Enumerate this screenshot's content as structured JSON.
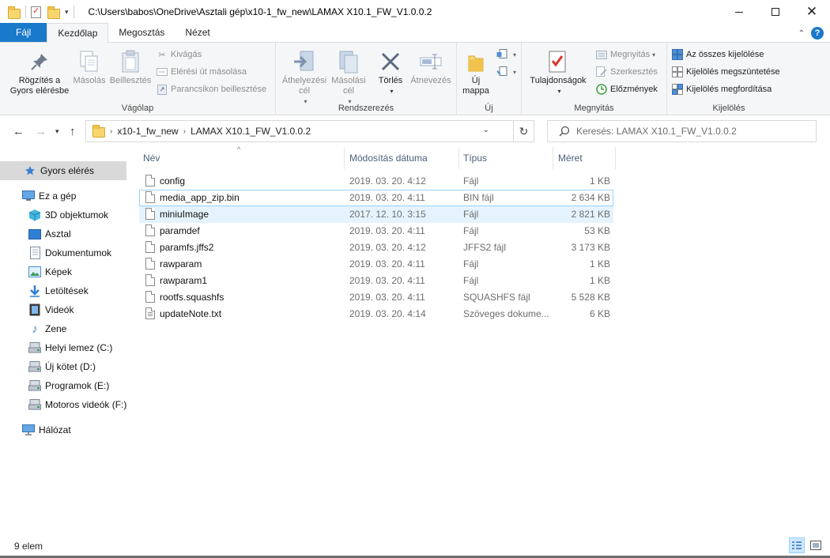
{
  "window": {
    "title_path": "C:\\Users\\babos\\OneDrive\\Asztali gép\\x10-1_fw_new\\LAMAX X10.1_FW_V1.0.0.2"
  },
  "tabs": [
    "Fájl",
    "Kezdőlap",
    "Megosztás",
    "Nézet"
  ],
  "ribbon": {
    "clipboard": {
      "pin": "Rögzítés a Gyors elérésbe",
      "copy": "Másolás",
      "paste": "Beillesztés",
      "cut": "Kivágás",
      "copy_path": "Elérési út másolása",
      "paste_shortcut": "Parancsikon beillesztése",
      "label": "Vágólap"
    },
    "organize": {
      "move_to": "Áthelyezési cél",
      "copy_to": "Másolási cél",
      "delete": "Törlés",
      "rename": "Átnevezés",
      "label": "Rendszerezés"
    },
    "new": {
      "new_folder": "Új mappa",
      "label": "Új"
    },
    "open": {
      "properties": "Tulajdonságok",
      "open": "Megnyitás",
      "edit": "Szerkesztés",
      "history": "Előzmények",
      "label": "Megnyitás"
    },
    "select": {
      "select_all": "Az összes kijelölése",
      "select_none": "Kijelölés megszüntetése",
      "invert": "Kijelölés megfordítása",
      "label": "Kijelölés"
    }
  },
  "address": {
    "crumbs": [
      "x10-1_fw_new",
      "LAMAX X10.1_FW_V1.0.0.2"
    ],
    "search_placeholder": "Keresés: LAMAX X10.1_FW_V1.0.0.2"
  },
  "nav": {
    "quick_access": "Gyors elérés",
    "this_pc": "Ez a gép",
    "objects3d": "3D objektumok",
    "desktop": "Asztal",
    "documents": "Dokumentumok",
    "pictures": "Képek",
    "downloads": "Letöltések",
    "videos": "Videók",
    "music": "Zene",
    "drive_c": "Helyi lemez (C:)",
    "drive_d": "Új kötet (D:)",
    "drive_e": "Programok (E:)",
    "drive_f": "Motoros videók (F:)",
    "network": "Hálózat"
  },
  "columns": {
    "name": "Név",
    "date": "Módosítás dátuma",
    "type": "Típus",
    "size": "Méret"
  },
  "files": [
    {
      "name": "config",
      "date": "2019. 03. 20. 4:12",
      "type": "Fájl",
      "size": "1 KB"
    },
    {
      "name": "media_app_zip.bin",
      "date": "2019. 03. 20. 4:11",
      "type": "BIN fájl",
      "size": "2 634 KB"
    },
    {
      "name": "miniuImage",
      "date": "2017. 12. 10. 3:15",
      "type": "Fájl",
      "size": "2 821 KB"
    },
    {
      "name": "paramdef",
      "date": "2019. 03. 20. 4:11",
      "type": "Fájl",
      "size": "53 KB"
    },
    {
      "name": "paramfs.jffs2",
      "date": "2019. 03. 20. 4:12",
      "type": "JFFS2 fájl",
      "size": "3 173 KB"
    },
    {
      "name": "rawparam",
      "date": "2019. 03. 20. 4:11",
      "type": "Fájl",
      "size": "1 KB"
    },
    {
      "name": "rawparam1",
      "date": "2019. 03. 20. 4:11",
      "type": "Fájl",
      "size": "1 KB"
    },
    {
      "name": "rootfs.squashfs",
      "date": "2019. 03. 20. 4:11",
      "type": "SQUASHFS fájl",
      "size": "5 528 KB"
    },
    {
      "name": "updateNote.txt",
      "date": "2019. 03. 20. 4:14",
      "type": "Szöveges dokume...",
      "size": "6 KB"
    }
  ],
  "status": {
    "count": "9 elem"
  },
  "colors": {
    "accent": "#1979ca",
    "hover": "#e5f3ff",
    "selection_border": "#99d1ff"
  }
}
